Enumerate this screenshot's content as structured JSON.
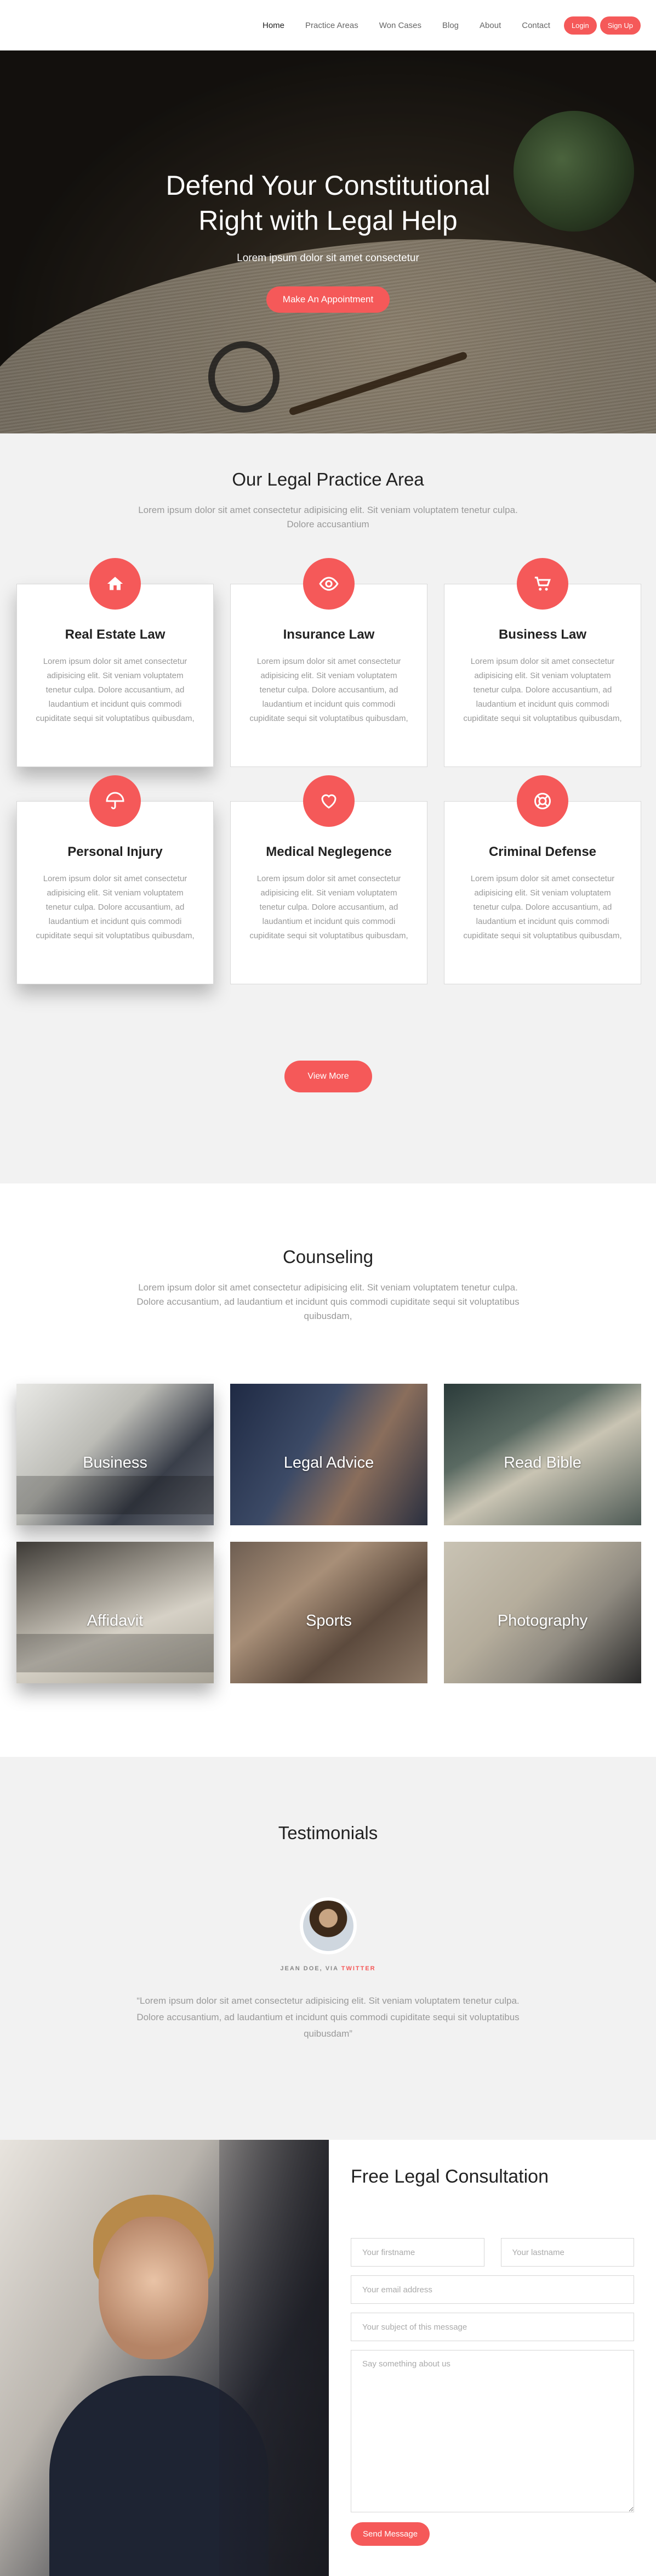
{
  "nav": {
    "links": [
      "Home",
      "Practice Areas",
      "Won Cases",
      "Blog",
      "About",
      "Contact"
    ],
    "login": "Login",
    "signup": "Sign Up"
  },
  "hero": {
    "title": "Defend Your Constitutional Right with Legal Help",
    "subtitle": "Lorem ipsum dolor sit amet consectetur",
    "cta": "Make An Appointment"
  },
  "practice": {
    "title": "Our Legal Practice Area",
    "description": "Lorem ipsum dolor sit amet consectetur adipisicing elit. Sit veniam voluptatem tenetur culpa. Dolore accusantium",
    "cards": [
      {
        "icon": "home-icon",
        "title": "Real Estate Law",
        "text": "Lorem ipsum dolor sit amet consectetur adipisicing elit. Sit veniam voluptatem tenetur culpa. Dolore accusantium, ad laudantium et incidunt quis commodi cupiditate sequi sit voluptatibus quibusdam,"
      },
      {
        "icon": "eye-icon",
        "title": "Insurance Law",
        "text": "Lorem ipsum dolor sit amet consectetur adipisicing elit. Sit veniam voluptatem tenetur culpa. Dolore accusantium, ad laudantium et incidunt quis commodi cupiditate sequi sit voluptatibus quibusdam,"
      },
      {
        "icon": "cart-icon",
        "title": "Business Law",
        "text": "Lorem ipsum dolor sit amet consectetur adipisicing elit. Sit veniam voluptatem tenetur culpa. Dolore accusantium, ad laudantium et incidunt quis commodi cupiditate sequi sit voluptatibus quibusdam,"
      },
      {
        "icon": "umbrella-icon",
        "title": "Personal Injury",
        "text": "Lorem ipsum dolor sit amet consectetur adipisicing elit. Sit veniam voluptatem tenetur culpa. Dolore accusantium, ad laudantium et incidunt quis commodi cupiditate sequi sit voluptatibus quibusdam,"
      },
      {
        "icon": "heart-icon",
        "title": "Medical Neglegence",
        "text": "Lorem ipsum dolor sit amet consectetur adipisicing elit. Sit veniam voluptatem tenetur culpa. Dolore accusantium, ad laudantium et incidunt quis commodi cupiditate sequi sit voluptatibus quibusdam,"
      },
      {
        "icon": "lifebuoy-icon",
        "title": "Criminal Defense",
        "text": "Lorem ipsum dolor sit amet consectetur adipisicing elit. Sit veniam voluptatem tenetur culpa. Dolore accusantium, ad laudantium et incidunt quis commodi cupiditate sequi sit voluptatibus quibusdam,"
      }
    ],
    "view_more": "View More"
  },
  "counseling": {
    "title": "Counseling",
    "description": "Lorem ipsum dolor sit amet consectetur adipisicing elit. Sit veniam voluptatem tenetur culpa. Dolore accusantium, ad laudantium et incidunt quis commodi cupiditate sequi sit voluptatibus quibusdam,",
    "tiles": [
      "Business",
      "Legal Advice",
      "Read Bible",
      "Affidavit",
      "Sports",
      "Photography"
    ]
  },
  "testimonials": {
    "title": "Testimonials",
    "author": "JEAN DOE, VIA",
    "via": "TWITTER",
    "quote": "“Lorem ipsum dolor sit amet consectetur adipisicing elit. Sit veniam voluptatem tenetur culpa. Dolore accusantium, ad laudantium et incidunt quis commodi cupiditate sequi sit voluptatibus quibusdam”"
  },
  "consultation": {
    "title": "Free Legal Consultation",
    "firstname_placeholder": "Your firstname",
    "lastname_placeholder": "Your lastname",
    "email_placeholder": "Your email address",
    "subject_placeholder": "Your subject of this message",
    "message_placeholder": "Say something about us",
    "send": "Send Message"
  },
  "colors": {
    "accent": "#f55959",
    "light_bg": "#f2f2f2"
  }
}
